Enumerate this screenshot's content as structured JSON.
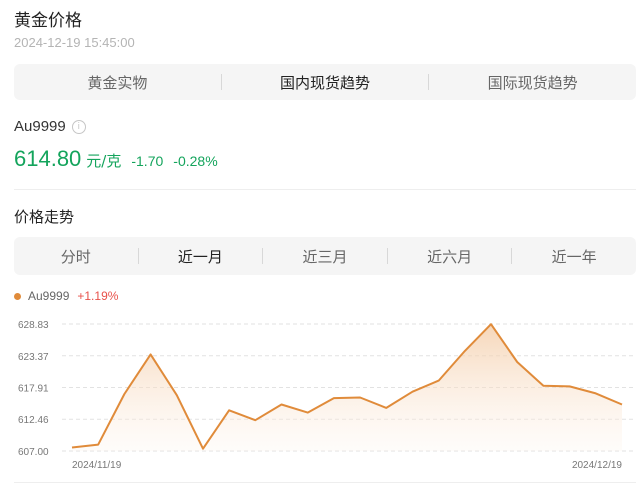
{
  "header": {
    "title": "黄金价格",
    "timestamp": "2024-12-19 15:45:00"
  },
  "main_tabs": [
    {
      "label": "黄金实物",
      "active": false
    },
    {
      "label": "国内现货趋势",
      "active": true
    },
    {
      "label": "国际现货趋势",
      "active": false
    }
  ],
  "quote": {
    "symbol": "Au9999",
    "info_icon": "info-icon",
    "price": "614.80",
    "unit": "元/克",
    "change": "-1.70",
    "change_pct": "-0.28%",
    "color": "#14a45c"
  },
  "trend": {
    "title": "价格走势",
    "tabs": [
      {
        "label": "分时",
        "active": false
      },
      {
        "label": "近一月",
        "active": true
      },
      {
        "label": "近三月",
        "active": false
      },
      {
        "label": "近六月",
        "active": false
      },
      {
        "label": "近一年",
        "active": false
      }
    ]
  },
  "legend": {
    "name": "Au9999",
    "change": "+1.19%",
    "series_color": "#e08b3a",
    "change_color": "#e8514a"
  },
  "chart_data": {
    "type": "area",
    "series": [
      {
        "name": "Au9999",
        "values": [
          607.6,
          608.1,
          616.8,
          623.6,
          616.6,
          607.4,
          614.0,
          612.3,
          615.0,
          613.6,
          616.1,
          616.2,
          614.4,
          617.2,
          619.1,
          624.2,
          628.8,
          622.3,
          618.2,
          618.1,
          616.9,
          615.0
        ]
      }
    ],
    "y_ticks": [
      "628.83",
      "623.37",
      "617.91",
      "612.46",
      "607.00"
    ],
    "ylim": [
      607.0,
      628.83
    ],
    "x_labels": [
      "2024/11/19",
      "2024/12/19"
    ],
    "grid": "horizontal-dashed",
    "line_color": "#e08b3a"
  }
}
